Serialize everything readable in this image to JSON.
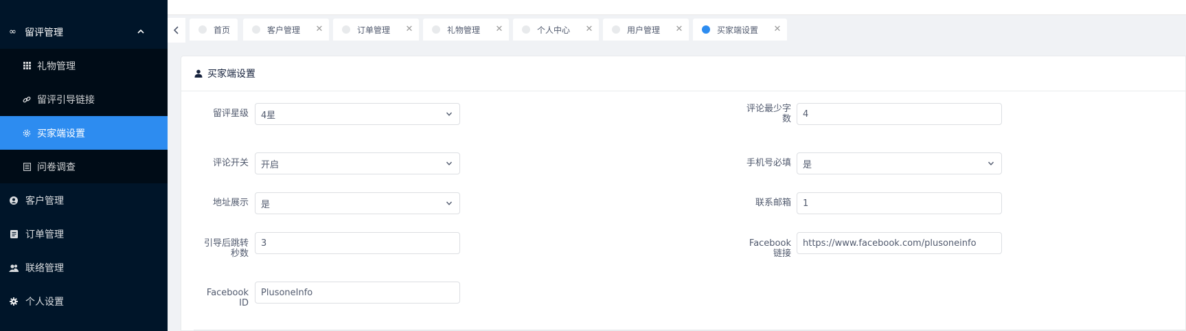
{
  "sidebar": {
    "group": {
      "label": "留评管理",
      "icon": "infinity-icon"
    },
    "sub_items": [
      {
        "label": "礼物管理",
        "icon": "grid-icon"
      },
      {
        "label": "留评引导链接",
        "icon": "link-icon"
      },
      {
        "label": "买家端设置",
        "icon": "gear-icon",
        "active": true
      },
      {
        "label": "问卷调查",
        "icon": "list-icon"
      }
    ],
    "top_items": [
      {
        "label": "客户管理",
        "icon": "user-circle-icon"
      },
      {
        "label": "订单管理",
        "icon": "document-icon"
      },
      {
        "label": "联络管理",
        "icon": "contacts-icon"
      },
      {
        "label": "个人设置",
        "icon": "cog-icon"
      }
    ]
  },
  "tabs": [
    {
      "label": "首页",
      "closable": false
    },
    {
      "label": "客户管理",
      "closable": true
    },
    {
      "label": "订单管理",
      "closable": true
    },
    {
      "label": "礼物管理",
      "closable": true
    },
    {
      "label": "个人中心",
      "closable": true
    },
    {
      "label": "用户管理",
      "closable": true
    },
    {
      "label": "买家端设置",
      "closable": true,
      "active": true
    }
  ],
  "card": {
    "title": "买家端设置",
    "icon": "user-icon"
  },
  "form": {
    "rating_star": {
      "label": "留评星级",
      "value": "4星"
    },
    "min_words": {
      "label_line1": "评论最少字",
      "label_line2": "数",
      "value": "4"
    },
    "review_switch": {
      "label": "评论开关",
      "value": "开启"
    },
    "phone_required": {
      "label": "手机号必填",
      "value": "是"
    },
    "address_show": {
      "label": "地址展示",
      "value": "是"
    },
    "contact_email": {
      "label": "联系邮箱",
      "value": "1"
    },
    "redirect_seconds": {
      "label_line1": "引导后跳转",
      "label_line2": "秒数",
      "value": "3"
    },
    "facebook_link": {
      "label_line1": "Facebook",
      "label_line2": "链接",
      "value": "https://www.facebook.com/plusoneinfo"
    },
    "facebook_id": {
      "label_line1": "Facebook",
      "label_line2": "ID",
      "value": "PlusoneInfo"
    }
  },
  "colors": {
    "sidebar_bg": "#001529",
    "submenu_bg": "#000c17",
    "accent": "#2d8cf0"
  }
}
